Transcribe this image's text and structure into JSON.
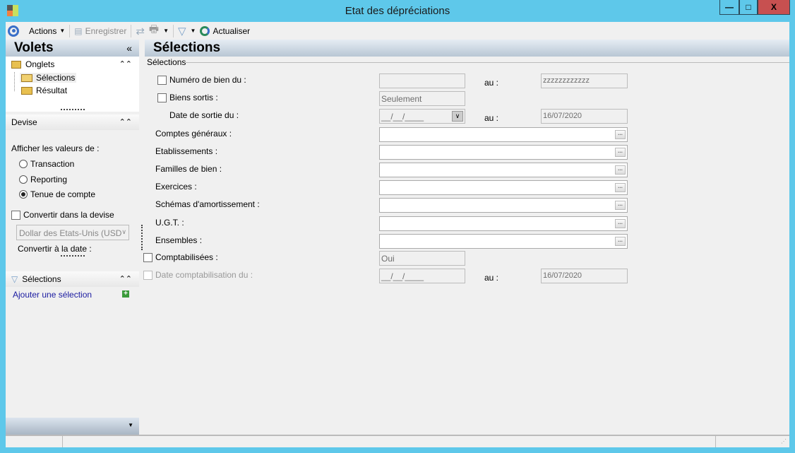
{
  "window": {
    "title": "Etat des dépréciations",
    "minimize": "—",
    "maximize": "□",
    "close": "X"
  },
  "toolbar": {
    "actions": "Actions",
    "save": "Enregistrer",
    "refresh": "Actualiser"
  },
  "sidebar": {
    "title": "Volets",
    "collapse": "«",
    "onglets": {
      "title": "Onglets",
      "items": [
        "Sélections",
        "Résultat"
      ]
    },
    "devise": {
      "title": "Devise",
      "show_values_label": "Afficher les valeurs de :",
      "options": [
        {
          "label": "Transaction",
          "selected": false
        },
        {
          "label": "Reporting",
          "selected": false
        },
        {
          "label": "Tenue de compte",
          "selected": true
        }
      ],
      "convert_label": "Convertir dans la devise",
      "currency": "Dollar des Etats-Unis (USD",
      "convert_date_label": "Convertir à la date :"
    },
    "selections": {
      "title": "Sélections",
      "add_link": "Ajouter une sélection"
    }
  },
  "main": {
    "title": "Sélections",
    "group_label": "Sélections",
    "to_label": "au :",
    "fields": {
      "numero": {
        "label": "Numéro de bien du :",
        "from": "",
        "to": "zzzzzzzzzzzz"
      },
      "biens_sortis": {
        "label": "Biens sortis :",
        "value": "Seulement"
      },
      "date_sortie": {
        "label": "Date de sortie du :",
        "from": "__/__/____",
        "to": "16/07/2020"
      },
      "comptes": {
        "label": "Comptes généraux :"
      },
      "etablissements": {
        "label": "Etablissements :"
      },
      "familles": {
        "label": "Familles de bien :"
      },
      "exercices": {
        "label": "Exercices :"
      },
      "schemas": {
        "label": "Schémas d'amortissement :"
      },
      "ugt": {
        "label": "U.G.T. :"
      },
      "ensembles": {
        "label": "Ensembles :"
      },
      "comptabilisees": {
        "label": "Comptabilisées :",
        "value": "Oui"
      },
      "date_compta": {
        "label": "Date comptabilisation du :",
        "from": "__/__/____",
        "to": "16/07/2020"
      }
    },
    "ellipsis": "..."
  }
}
